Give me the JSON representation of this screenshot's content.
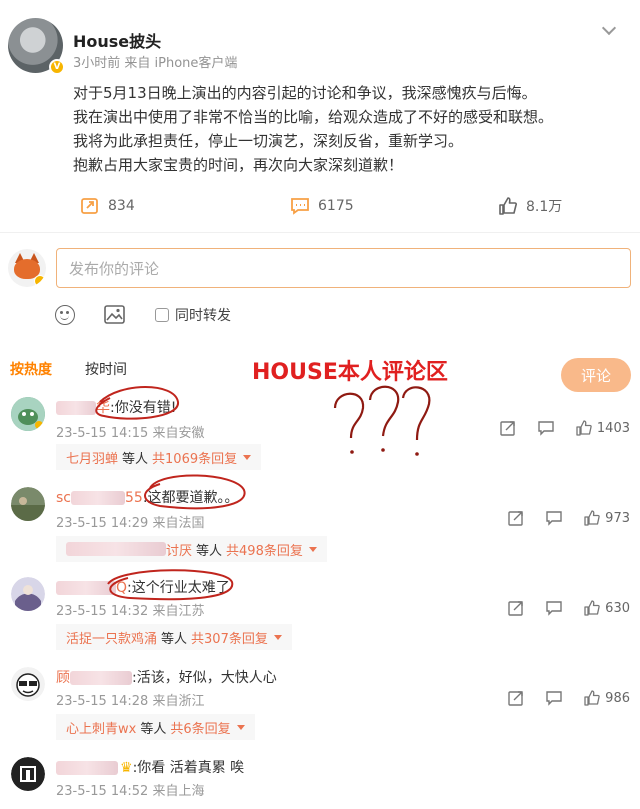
{
  "post": {
    "username": "House披头",
    "meta": "3小时前  来自 iPhone客户端",
    "lines": [
      "对于5月13日晚上演出的内容引起的讨论和争议，我深感愧疚与后悔。",
      "我在演出中使用了非常不恰当的比喻，给观众造成了不好的感受和联想。",
      "我将为此承担责任，停止一切演艺，深刻反省，重新学习。",
      "抱歉占用大家宝贵的时间，再次向大家深刻道歉！"
    ],
    "repost_count": "834",
    "comment_count": "6175",
    "like_count": "8.1万"
  },
  "compose": {
    "placeholder": "发布你的评论",
    "repost_label": "同时转发",
    "annotation": "HOUSE本人评论区",
    "submit_label": "评论"
  },
  "tabs": {
    "hot": "按热度",
    "time": "按时间"
  },
  "question_marks": "???",
  "comments": [
    {
      "name_prefix": "",
      "name_suffix": "华",
      "text": ":你没有错!",
      "meta": "23-5-15 14:15  来自安徽",
      "likes": "1403",
      "reply_nick": "七月羽蝉",
      "reply_mid": "等人",
      "reply_count": "共1069条回复"
    },
    {
      "name_prefix": "sc",
      "name_suffix": "55",
      "text": ":这都要道歉。。",
      "meta": "23-5-15 14:29  来自法国",
      "likes": "973",
      "reply_nick": "讨厌",
      "reply_mid": "等人",
      "reply_count": "共498条回复"
    },
    {
      "name_prefix": "",
      "name_suffix": "Q",
      "text": ":这个行业太难了",
      "meta": "23-5-15 14:32  来自江苏",
      "likes": "630",
      "reply_nick": "活捉一只款鸡涌",
      "reply_mid": "等人",
      "reply_count": "共307条回复"
    },
    {
      "name_prefix": "顾",
      "name_suffix": "",
      "text": ":活该，好似，大快人心",
      "meta": "23-5-15 14:28  来自浙江",
      "likes": "986",
      "reply_nick": "心上刺青wx",
      "reply_mid": "等人",
      "reply_count": "共6条回复"
    },
    {
      "name_prefix": "",
      "name_suffix": "",
      "text": ":你看 活着真累 唉",
      "meta": "23-5-15 14:52  来自上海",
      "likes": "",
      "reply_nick": "",
      "reply_mid": "",
      "reply_count": ""
    }
  ],
  "colors": {
    "accent": "#ff8200",
    "nick": "#eb7350",
    "annotation": "#e02020",
    "submit": "#f9b98a"
  },
  "icons": [
    "more-chevron-icon",
    "repost-icon",
    "comment-icon",
    "like-icon",
    "emoji-icon",
    "image-icon",
    "share-icon",
    "reply-icon",
    "vip-badge-icon"
  ]
}
